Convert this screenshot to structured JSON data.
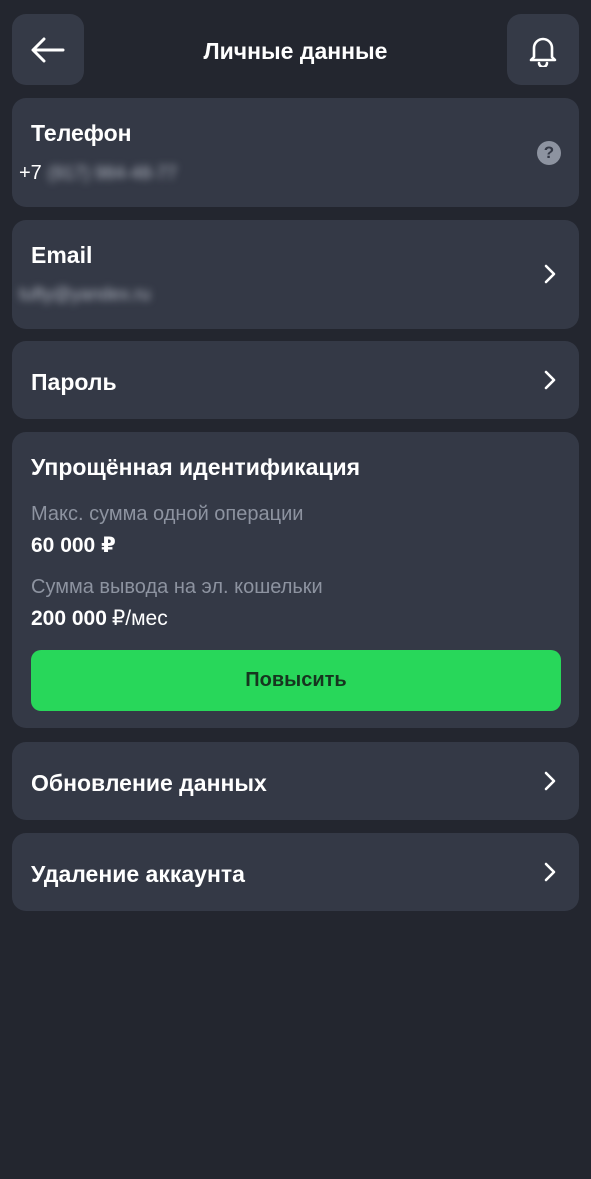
{
  "header": {
    "title": "Личные данные"
  },
  "phone": {
    "label": "Телефон",
    "prefix": "+7",
    "masked_number": "(917) 984-48-77"
  },
  "email": {
    "label": "Email",
    "masked_value": "tufty@yandex.ru"
  },
  "password": {
    "label": "Пароль"
  },
  "identification": {
    "title": "Упрощённая идентификация",
    "max_operation_label": "Макс. сумма одной операции",
    "max_operation_value": "60 000",
    "max_operation_currency": "₽",
    "withdraw_label": "Сумма вывода на эл. кошельки",
    "withdraw_value": "200 000",
    "withdraw_unit": "₽/мес",
    "upgrade_button": "Повысить"
  },
  "update_data": {
    "label": "Обновление данных"
  },
  "delete_account": {
    "label": "Удаление аккаунта"
  },
  "colors": {
    "background": "#23262f",
    "card": "#343946",
    "accent_green": "#28d75a",
    "muted_text": "#8d93a0"
  },
  "icons": {
    "back": "arrow-left-icon",
    "notifications": "bell-icon",
    "help": "question-circle-icon",
    "navigate": "chevron-right-icon"
  }
}
